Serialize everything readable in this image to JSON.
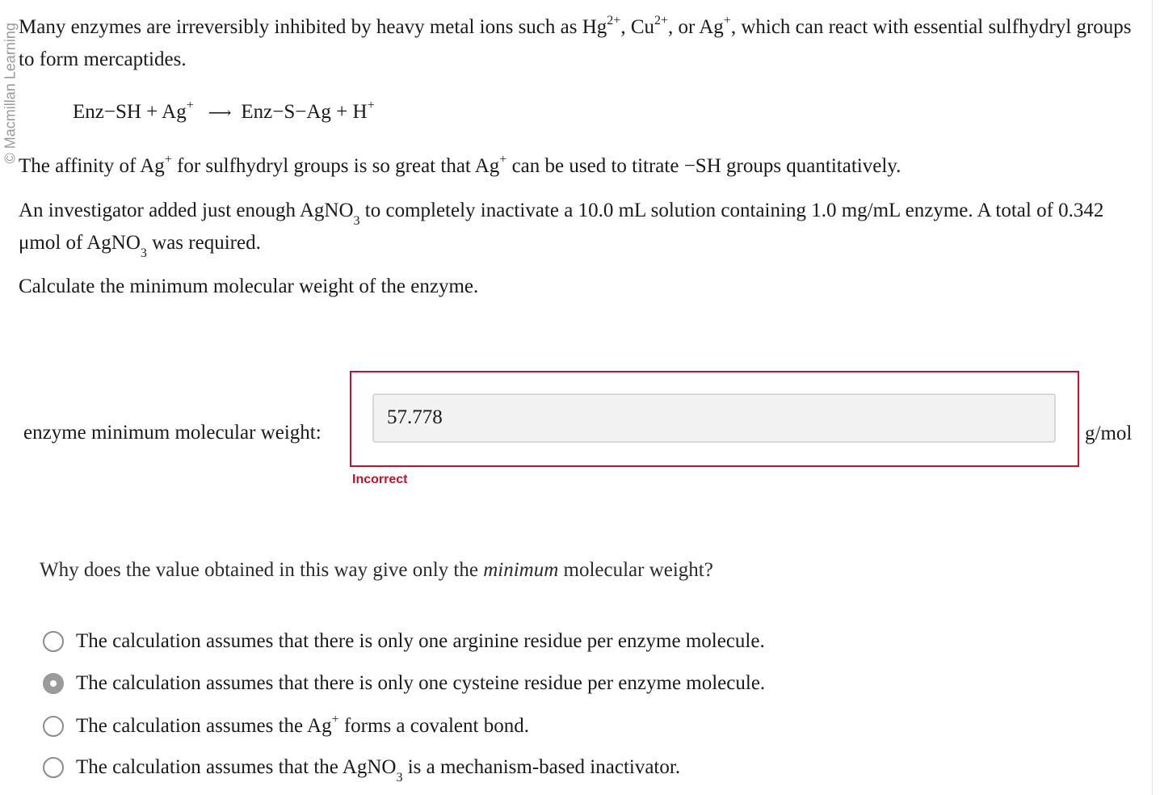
{
  "watermark": "© Macmillan Learning",
  "intro": {
    "p1_a": "Many enzymes are irreversibly inhibited by heavy metal ions such as Hg",
    "p1_hg_sup": "2+",
    "p1_b": ", Cu",
    "p1_cu_sup": "2+",
    "p1_c": ", or Ag",
    "p1_ag_sup": "+",
    "p1_d": ", which can react with essential sulfhydryl groups to form mercaptides."
  },
  "equation": {
    "left": "Enz−SH + Ag",
    "left_sup": "+",
    "arrow": "⟶",
    "right": "Enz−S−Ag + H",
    "right_sup": "+"
  },
  "affinity": {
    "a": "The affinity of Ag",
    "sup1": "+",
    "b": " for sulfhydryl groups is so great that Ag",
    "sup2": "+",
    "c": " can be used to titrate −SH groups quantitatively."
  },
  "investigator": {
    "a": "An investigator added just enough AgNO",
    "sub1": "3",
    "b": " to completely inactivate a 10.0 mL solution containing 1.0 mg/mL enzyme. A total of 0.342 μmol of AgNO",
    "sub2": "3",
    "c": " was required."
  },
  "prompt": "Calculate the minimum molecular weight of the enzyme.",
  "answer": {
    "label": "enzyme minimum molecular weight:",
    "value": "57.778",
    "unit": "g/mol",
    "status": "Incorrect"
  },
  "question": {
    "a": "Why does the value obtained in this way give only the ",
    "em": "minimum",
    "b": " molecular weight?"
  },
  "options": [
    {
      "text": "The calculation assumes that there is only one arginine residue per enzyme molecule.",
      "selected": false
    },
    {
      "text": "The calculation assumes that there is only one cysteine residue per enzyme molecule.",
      "selected": true
    },
    {
      "pre": "The calculation assumes the Ag",
      "sup": "+",
      "post": " forms a covalent bond.",
      "selected": false
    },
    {
      "pre": "The calculation assumes that the AgNO",
      "sub": "3",
      "post": " is a mechanism-based inactivator.",
      "selected": false
    }
  ],
  "colors": {
    "error": "#c8102e",
    "input_bg": "#f2f2f2"
  }
}
